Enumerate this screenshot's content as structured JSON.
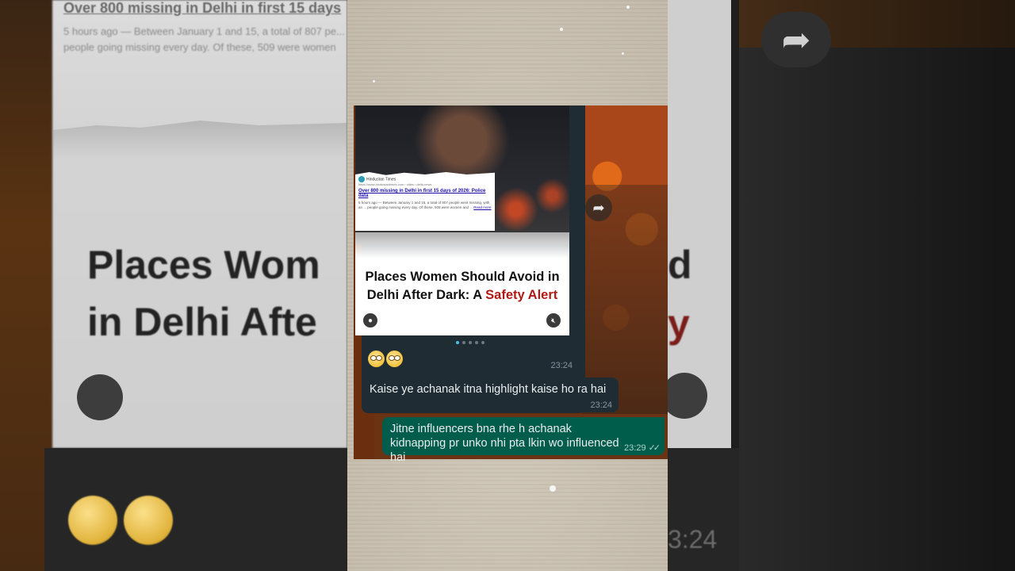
{
  "background": {
    "headline": "Over 800 missing in Delhi in first 15 days",
    "snippet": "5 hours ago — Between January 1 and 15, a total of 807 pe... people going missing every day. Of these, 509 were women",
    "title_left": "Places Wom\nin Delhi Afte",
    "title_right_1": "d",
    "title_right_2": "y",
    "time": "3:24"
  },
  "media": {
    "source": "Hindustan Times",
    "url": "https://www.hindustantimes.com › cities › delhi-news",
    "headline": "Over 800 missing in Delhi in first 15 days of 2026: Police data",
    "snippet": "5 hours ago — Between January 1 and 15, a total of 807 people went missing, with an ... people going missing every day. Of these, 509 were women and ...",
    "read_more": "Read more",
    "title_part1": "Places Women Should Avoid in Delhi After Dark: A ",
    "title_part2": "Safety Alert",
    "caption_time": "23:24"
  },
  "messages": [
    {
      "text": "Kaise ye achanak itna highlight kaise ho ra hai",
      "time": "23:24",
      "direction": "incoming"
    },
    {
      "text": "Jitne influencers bna rhe h achanak kidnapping pr unko nhi pta lkin wo influenced hai",
      "time": "23:29",
      "direction": "outgoing",
      "read": "✓✓"
    }
  ],
  "icons": {
    "forward": "forward-arrow-icon",
    "avatar": "person-icon",
    "mute": "mute-icon",
    "emoji": "face-with-rolling-eyes"
  },
  "colors": {
    "incoming_bubble": "#1f2c34",
    "outgoing_bubble": "#005c4b",
    "title_accent": "#b01a14"
  },
  "carousel": {
    "count": 5,
    "active": 1
  }
}
